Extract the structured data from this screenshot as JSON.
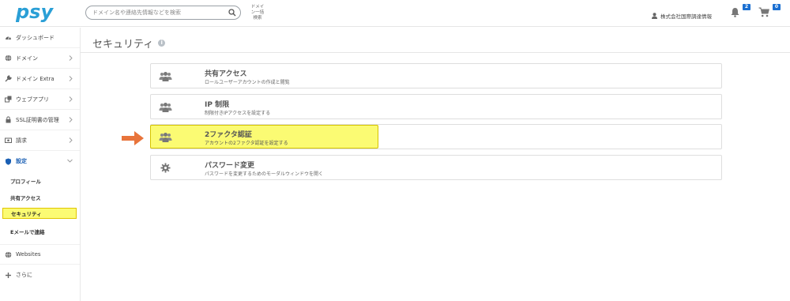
{
  "header": {
    "logo_text": "psy",
    "search_placeholder": "ドメイン名や連絡先情報などを検索",
    "search_help": [
      "ドメイ",
      "ン一括",
      "検索"
    ],
    "company": "株式会社国際調達情報",
    "notifications_count": "2",
    "cart_count": "0"
  },
  "sidebar": {
    "items": [
      {
        "label": "ダッシュボード",
        "icon": "dashboard-icon"
      },
      {
        "label": "ドメイン",
        "icon": "globe-icon"
      },
      {
        "label": "ドメイン Extra",
        "icon": "wrench-icon"
      },
      {
        "label": "ウェブアプリ",
        "icon": "apps-icon"
      },
      {
        "label": "SSL証明書の管理",
        "icon": "lock-icon"
      },
      {
        "label": "請求",
        "icon": "billing-icon"
      },
      {
        "label": "設定",
        "icon": "shield-icon"
      }
    ],
    "sub_items": [
      {
        "label": "プロフィール"
      },
      {
        "label": "共有アクセス"
      },
      {
        "label": "セキュリティ"
      },
      {
        "label": "Eメールで連絡"
      }
    ],
    "bottom_items": [
      {
        "label": "Websites",
        "icon": "globe-icon"
      },
      {
        "label": "さらに",
        "icon": "plus-icon"
      }
    ]
  },
  "main": {
    "title": "セキュリティ",
    "cards": [
      {
        "title": "共有アクセス",
        "subtitle": "ロールユーザーアカウントの作成と閲覧",
        "icon": "users-icon"
      },
      {
        "title": "IP 制限",
        "subtitle": "制限付きIPアクセスを設定する",
        "icon": "users-icon"
      },
      {
        "title": "2ファクタ認証",
        "subtitle": "アカウントの2ファクタ認証を設定する",
        "icon": "users-icon"
      },
      {
        "title": "パスワード変更",
        "subtitle": "パスワードを変更するためのモーダルウィンドウを開く",
        "icon": "gear-icon"
      }
    ]
  },
  "colors": {
    "accent": "#1a5fb4",
    "highlight": "#fbfb73",
    "arrow": "#e8743b",
    "badge": "#1a6fd1"
  }
}
